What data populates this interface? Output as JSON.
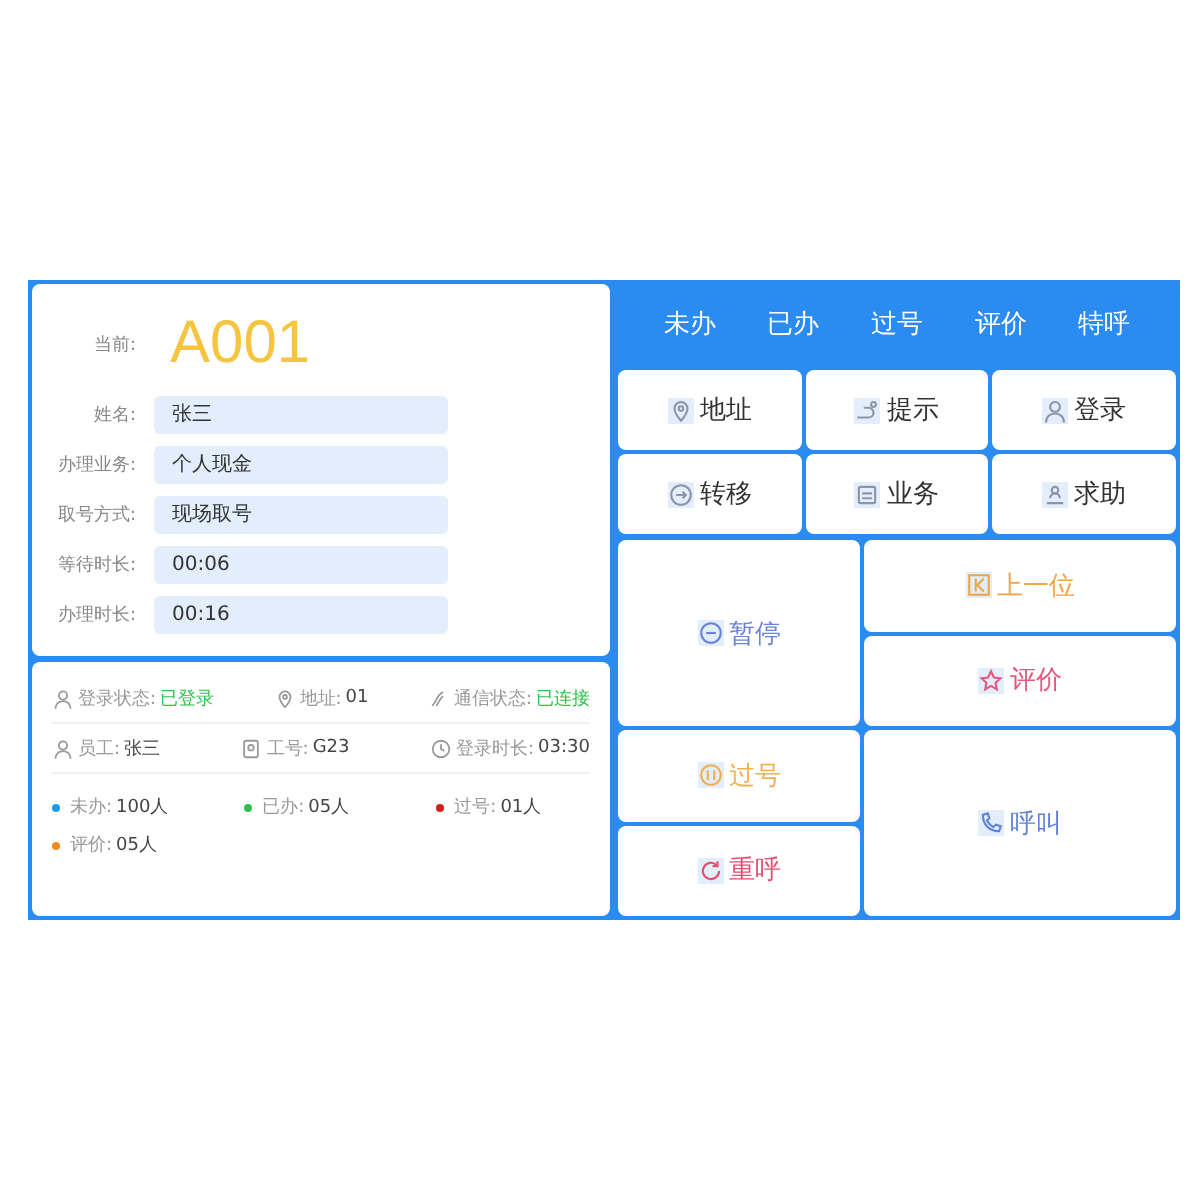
{
  "current": {
    "label": "当前:",
    "number": "A001"
  },
  "fields": [
    {
      "label": "姓名:",
      "value": "张三"
    },
    {
      "label": "办理业务:",
      "value": "个人现金"
    },
    {
      "label": "取号方式:",
      "value": "现场取号"
    },
    {
      "label": "等待时长:",
      "value": "00:06"
    },
    {
      "label": "办理时长:",
      "value": "00:16"
    }
  ],
  "status_rows": [
    [
      {
        "label": "登录状态:",
        "value": "已登录",
        "highlight": true
      },
      {
        "label": "地址:",
        "value": "01",
        "highlight": false
      },
      {
        "label": "通信状态:",
        "value": "已连接",
        "highlight": true
      }
    ],
    [
      {
        "label": "员工:",
        "value": "张三",
        "highlight": false
      },
      {
        "label": "工号:",
        "value": "G23",
        "highlight": false
      },
      {
        "label": "登录时长:",
        "value": "03:30",
        "highlight": false
      }
    ]
  ],
  "counts": [
    {
      "label": "未办:",
      "value": "100人",
      "color": "#1e9be8"
    },
    {
      "label": "已办:",
      "value": "05人",
      "color": "#2ec04a"
    },
    {
      "label": "过号:",
      "value": "01人",
      "color": "#d42020"
    },
    {
      "label": "评价:",
      "value": "05人",
      "color": "#f08a20"
    }
  ],
  "tabs": [
    {
      "label": "未办"
    },
    {
      "label": "已办"
    },
    {
      "label": "过号"
    },
    {
      "label": "评价"
    },
    {
      "label": "特呼"
    }
  ],
  "tool_buttons": [
    {
      "label": "地址"
    },
    {
      "label": "提示"
    },
    {
      "label": "登录"
    },
    {
      "label": "转移"
    },
    {
      "label": "业务"
    },
    {
      "label": "求助"
    }
  ],
  "action_buttons": [
    {
      "label": "暂停",
      "color": "#6a82d8"
    },
    {
      "label": "上一位",
      "color": "#f0a444"
    },
    {
      "label": "评价",
      "color": "#e4587e"
    },
    {
      "label": "过号",
      "color": "#f0b050"
    },
    {
      "label": "重呼",
      "color": "#e45070"
    },
    {
      "label": "呼叫",
      "color": "#5f82d8"
    }
  ]
}
